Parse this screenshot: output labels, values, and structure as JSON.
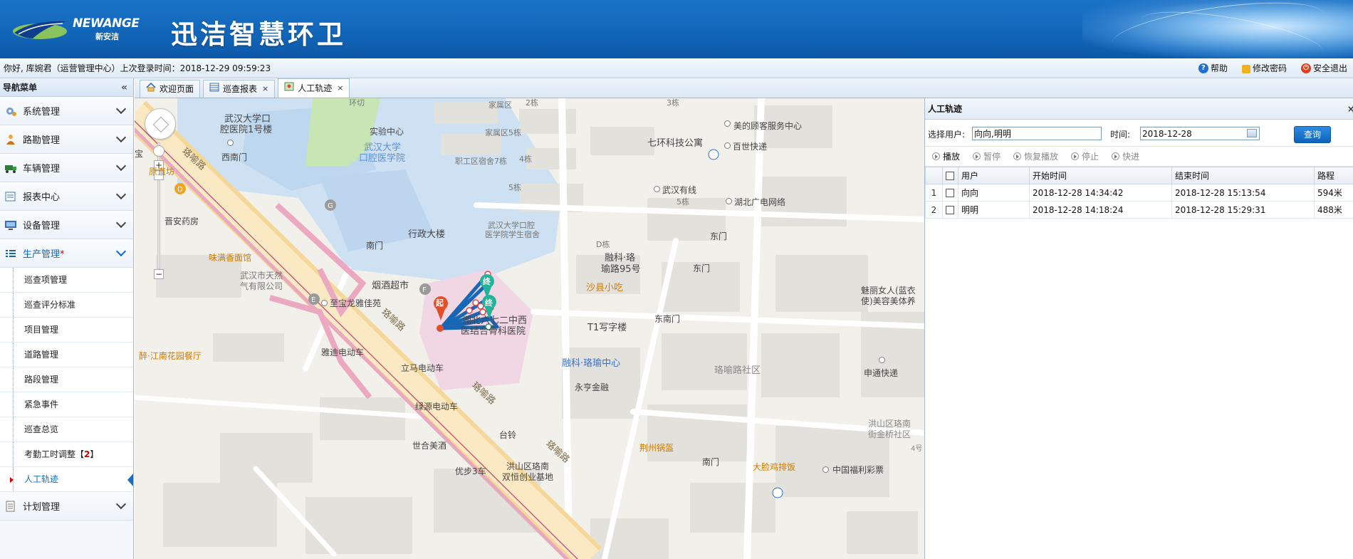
{
  "header": {
    "logo_text": "NEWANGE",
    "logo_sub": "新安洁",
    "app_title": "迅洁智慧环卫"
  },
  "userbar": {
    "greeting": "你好, 库婉君（运营管理中心）上次登录时间：2018-12-29 09:59:23",
    "help": "帮助",
    "change_password": "修改密码",
    "logout": "安全退出"
  },
  "sidebar": {
    "title": "导航菜单",
    "collapse": "«",
    "menus_top": [
      {
        "label": "系统管理"
      },
      {
        "label": "路勘管理"
      },
      {
        "label": "车辆管理"
      },
      {
        "label": "报表中心"
      },
      {
        "label": "设备管理"
      }
    ],
    "active_menu": {
      "label": "生产管理",
      "star": "*"
    },
    "sub_items": [
      {
        "label": "巡查项管理"
      },
      {
        "label": "巡查评分标准"
      },
      {
        "label": "项目管理"
      },
      {
        "label": "道路管理"
      },
      {
        "label": "路段管理"
      },
      {
        "label": "紧急事件"
      },
      {
        "label": "巡查总览"
      },
      {
        "label": "考勤工时调整【",
        "num": "2",
        "tail": "】"
      },
      {
        "label": "人工轨迹"
      }
    ],
    "menus_bottom": [
      {
        "label": "计划管理"
      }
    ]
  },
  "tabs": [
    {
      "label": "欢迎页面"
    },
    {
      "label": "巡查报表",
      "close": "×"
    },
    {
      "label": "人工轨迹",
      "close": "×"
    }
  ],
  "map": {
    "zoom_in": "+",
    "zoom_out": "−",
    "labels": {
      "l1": "武汉大学口",
      "l1b": "腔医院1号楼",
      "l2": "西南门",
      "l3": "实验中心",
      "l4": "武汉大学",
      "l4b": "口腔医学院",
      "l5": "家属区",
      "l5b": "家属区5栋",
      "l6": "职工区宿舍7栋",
      "l7": "4栋",
      "l8": "5栋",
      "l9": "美的顾客服务中心",
      "l10": "七环科技公寓",
      "l11": "百世快递",
      "l12": "武汉有线",
      "l13": "5栋",
      "l14": "湖北广电网络",
      "l15": "东门",
      "l16": "原直坊",
      "l17": "晋安药房",
      "l18": "南门",
      "l19": "行政大楼",
      "l20": "武汉大学口腔",
      "l20b": "医学院学生宿舍",
      "l21": "D栋",
      "l22": "融科·珞",
      "l22b": "瑜路95号",
      "l23": "东门",
      "l24": "味满香面馆",
      "l25": "武汉市天然",
      "l25b": "气有限公司",
      "l26": "烟酒超市",
      "l27": "沙县小吃",
      "l28": "至宝龙雅佳苑",
      "l29": "湖北六七二中西",
      "l29b": "医结合骨科医院",
      "l30": "T1写字楼",
      "l31": "东南门",
      "l32": "魅丽女人(蓝衣",
      "l32b": "使)美容美体养",
      "l33": "醉·江南花园餐厅",
      "l34": "雅迪电动车",
      "l35": "融科·珞瑜中心",
      "l36": "珞喻路社区",
      "l37": "立马电动车",
      "l38": "永亨金融",
      "l39": "申通快递",
      "l40": "绿源电动车",
      "l41": "台铃",
      "l42": "世合美酒",
      "l43": "荆州锅盔",
      "l44": "洪山区珞南",
      "l44b": "双恒创业基地",
      "l45": "优步3车",
      "l46": "南门",
      "l47": "大脸鸡排饭",
      "l48": "中国福利彩票",
      "l49": "洪山区珞南",
      "l49b": "街金桥社区",
      "l50": "4号",
      "road1": "珞喻路",
      "road2": "珞喻路",
      "road3": "珞喻路",
      "road4": "珞喻路",
      "start": "起",
      "end1": "终",
      "end2": "终",
      "l51": "环切",
      "l52": "3栋",
      "l53": "2栋",
      "l54": "宝"
    }
  },
  "panel": {
    "title": "人工轨迹",
    "close": "×",
    "user_label": "选择用户:",
    "user_value": "向向,明明",
    "time_label": "时间:",
    "time_value": "2018-12-28",
    "query": "查询",
    "tools": [
      {
        "label": "播放"
      },
      {
        "label": "暂停"
      },
      {
        "label": "恢复播放"
      },
      {
        "label": "停止"
      },
      {
        "label": "快进"
      }
    ],
    "columns": [
      "用户",
      "开始时间",
      "结束时间",
      "路程"
    ],
    "rows": [
      {
        "no": "1",
        "user": "向向",
        "start": "2018-12-28 14:34:42",
        "end": "2018-12-28 15:13:54",
        "distance": "594米"
      },
      {
        "no": "2",
        "user": "明明",
        "start": "2018-12-28 14:18:24",
        "end": "2018-12-28 15:29:31",
        "distance": "488米"
      }
    ]
  }
}
